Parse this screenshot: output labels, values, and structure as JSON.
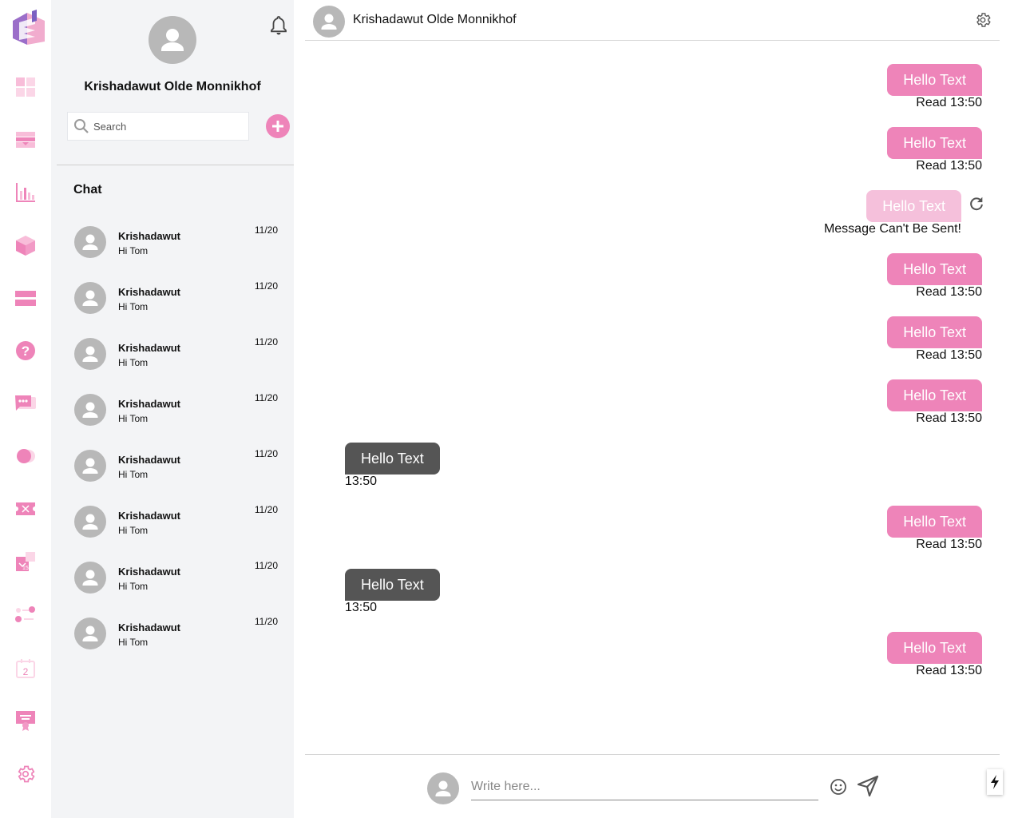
{
  "app": {
    "accent_color": "#ee84b9",
    "accent_light": "#f5c0db",
    "incoming_color": "#555555"
  },
  "rail": {
    "logo": "app-logo",
    "items": [
      {
        "icon": "dashboard-icon"
      },
      {
        "icon": "payment-card-icon"
      },
      {
        "icon": "bar-chart-icon"
      },
      {
        "icon": "box-icon"
      },
      {
        "icon": "card-icon"
      },
      {
        "icon": "help-icon"
      },
      {
        "icon": "chat-icon"
      },
      {
        "icon": "toggle-icon"
      },
      {
        "icon": "ticket-icon"
      },
      {
        "icon": "puzzle-icon"
      },
      {
        "icon": "sliders-icon"
      },
      {
        "icon": "calendar-icon"
      },
      {
        "icon": "certificate-icon"
      },
      {
        "icon": "settings-icon"
      }
    ],
    "calendar_day": "2"
  },
  "panel": {
    "user_name": "Krishadawut Olde Monnikhof",
    "search_placeholder": "Search",
    "section_title": "Chat",
    "chats": [
      {
        "name": "Krishadawut",
        "last_message": "Hi Tom",
        "date": "11/20"
      },
      {
        "name": "Krishadawut",
        "last_message": "Hi Tom",
        "date": "11/20"
      },
      {
        "name": "Krishadawut",
        "last_message": "Hi Tom",
        "date": "11/20"
      },
      {
        "name": "Krishadawut",
        "last_message": "Hi Tom",
        "date": "11/20"
      },
      {
        "name": "Krishadawut",
        "last_message": "Hi Tom",
        "date": "11/20"
      },
      {
        "name": "Krishadawut",
        "last_message": "Hi Tom",
        "date": "11/20"
      },
      {
        "name": "Krishadawut",
        "last_message": "Hi Tom",
        "date": "11/20"
      },
      {
        "name": "Krishadawut",
        "last_message": "Hi Tom",
        "date": "11/20"
      }
    ]
  },
  "conversation": {
    "contact_name": "Krishadawut Olde Monnikhof",
    "messages": [
      {
        "direction": "out",
        "text": "Hello Text",
        "status": "Read 13:50"
      },
      {
        "direction": "out",
        "text": "Hello Text",
        "status": "Read 13:50"
      },
      {
        "direction": "failed",
        "text": "Hello Text",
        "status": "Message Can't Be Sent!"
      },
      {
        "direction": "out",
        "text": "Hello Text",
        "status": "Read 13:50"
      },
      {
        "direction": "out",
        "text": "Hello Text",
        "status": "Read 13:50"
      },
      {
        "direction": "out",
        "text": "Hello Text",
        "status": "Read 13:50"
      },
      {
        "direction": "in",
        "text": "Hello Text",
        "status": "13:50"
      },
      {
        "direction": "out",
        "text": "Hello Text",
        "status": "Read 13:50"
      },
      {
        "direction": "in",
        "text": "Hello Text",
        "status": "13:50"
      },
      {
        "direction": "out",
        "text": "Hello Text",
        "status": "Read 13:50"
      }
    ],
    "compose_placeholder": "Write here..."
  }
}
